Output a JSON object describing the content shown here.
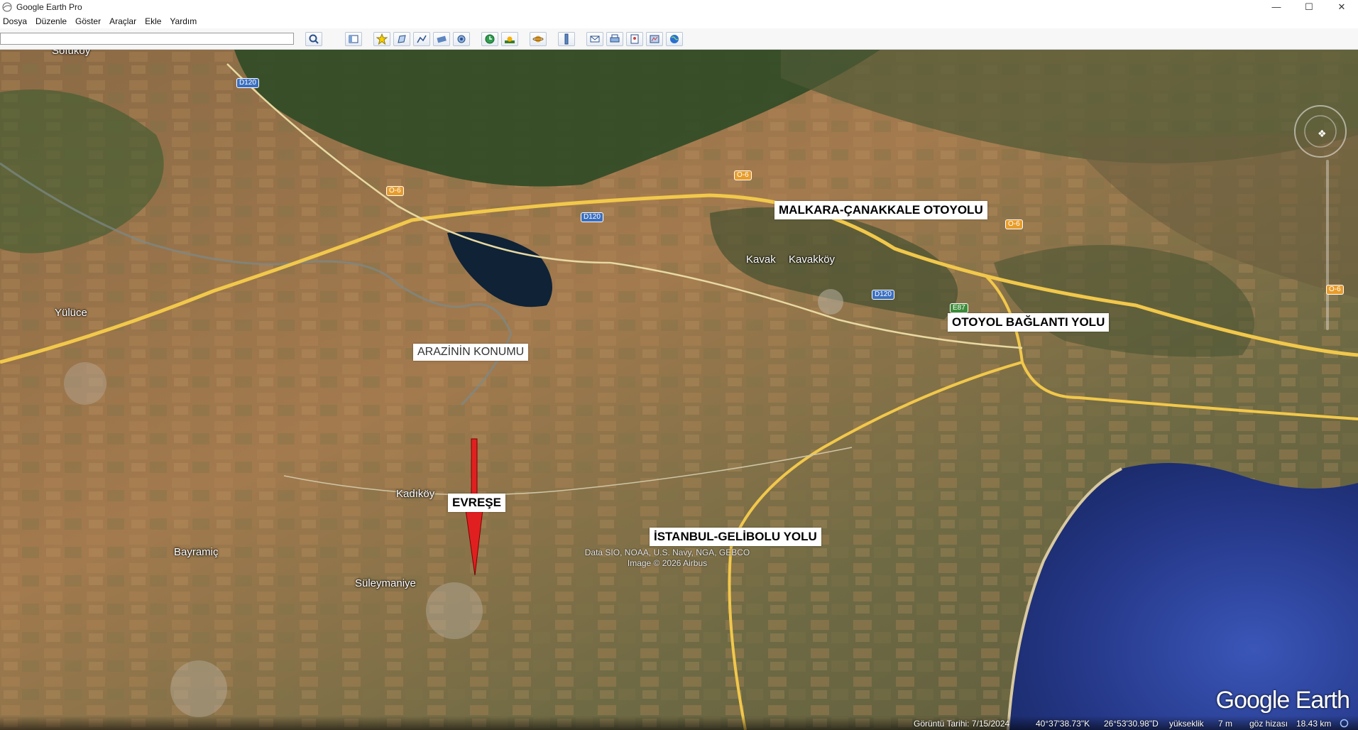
{
  "window": {
    "title": "Google Earth Pro"
  },
  "menu": [
    "Dosya",
    "Düzenle",
    "Göster",
    "Araçlar",
    "Ekle",
    "Yardım"
  ],
  "search": {
    "value": "",
    "placeholder": ""
  },
  "map": {
    "places": {
      "sofukoy": "Sofuköy",
      "yuluce": "Yülüce",
      "kavak": "Kavak",
      "kavakkoy": "Kavakköy",
      "kadikoy": "Kadıköy",
      "bayramic": "Bayramiç",
      "suleymaniye": "Süleymaniye"
    },
    "road_shields": {
      "d120_a": "D120",
      "d120_b": "D120",
      "d120_c": "D120",
      "o6_a": "O-6",
      "o6_b": "O-6",
      "o6_c": "O-6",
      "o6_d": "O-6",
      "e87": "E87"
    },
    "callouts": {
      "malkara": "MALKARA-ÇANAKKALE OTOYOLU",
      "baglanti": "OTOYOL BAĞLANTI YOLU",
      "arazi": "ARAZİNİN KONUMU",
      "evrese": "EVREŞE",
      "gelibolu": "İSTANBUL-GELİBOLU YOLU"
    },
    "attribution": {
      "line1": "Data SIO, NOAA, U.S. Navy, NGA, GEBCO",
      "line2": "Image © 2026 Airbus"
    },
    "logo": "Google Earth",
    "colors": {
      "arrow": "#e02020",
      "water": "#2a3f8f",
      "highway": "#f2c84b"
    }
  },
  "status": {
    "date_label": "Görüntü Tarihi: 7/15/2024",
    "lat": "40°37'38.73\"K",
    "lon": "26°53'30.98\"D",
    "elev_label": "yükseklik",
    "elev_value": "7 m",
    "eye_label": "göz hizası",
    "eye_value": "18.43 km"
  }
}
